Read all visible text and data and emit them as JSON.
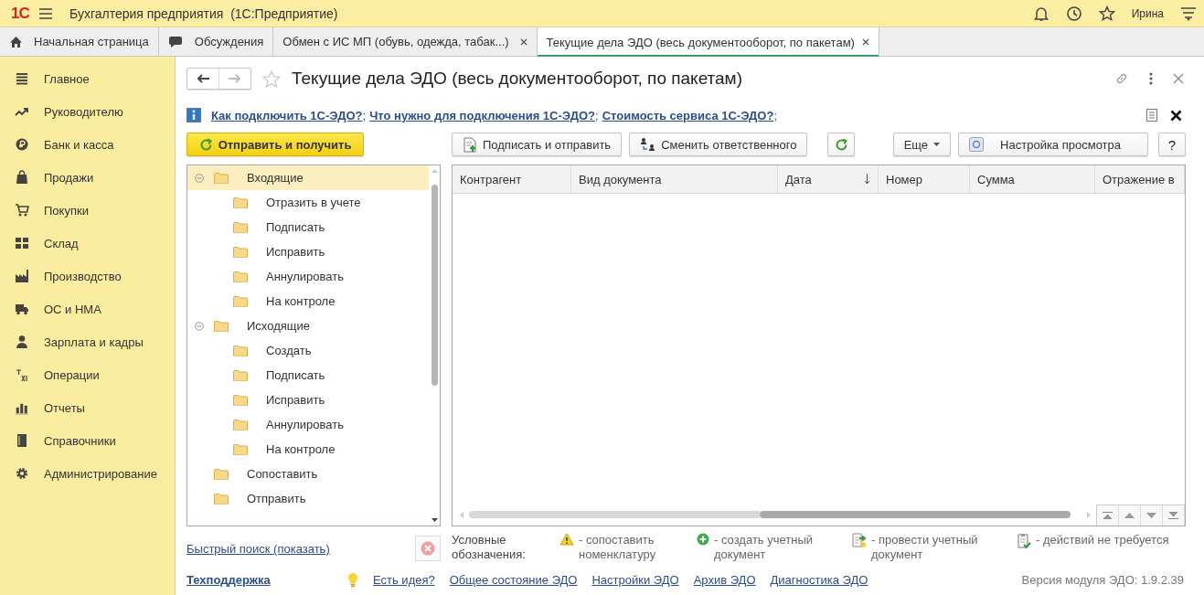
{
  "app": {
    "logo": "1С",
    "title": "Бухгалтерия предприятия  (1С:Предприятие)",
    "user": "Ирина"
  },
  "tabs": [
    {
      "label": "Начальная страница",
      "kind": "home",
      "selected": false,
      "closable": false
    },
    {
      "label": "Обсуждения",
      "kind": "chat",
      "selected": false,
      "closable": false
    },
    {
      "label": "Обмен с ИС МП (обувь, одежда, табак...)",
      "kind": "plain",
      "selected": false,
      "closable": true
    },
    {
      "label": "Текущие дела ЭДО (весь документооборот, по пакетам)",
      "kind": "plain",
      "selected": true,
      "closable": true
    }
  ],
  "sidebar": {
    "items": [
      {
        "label": "Главное"
      },
      {
        "label": "Руководителю"
      },
      {
        "label": "Банк и касса"
      },
      {
        "label": "Продажи"
      },
      {
        "label": "Покупки"
      },
      {
        "label": "Склад"
      },
      {
        "label": "Производство"
      },
      {
        "label": "ОС и НМА"
      },
      {
        "label": "Зарплата и кадры"
      },
      {
        "label": "Операции"
      },
      {
        "label": "Отчеты"
      },
      {
        "label": "Справочники"
      },
      {
        "label": "Администрирование"
      }
    ]
  },
  "form": {
    "title": "Текущие дела ЭДО (весь документооборот, по пакетам)",
    "favorite": false,
    "info_links": [
      {
        "label": "Как подключить 1С-ЭДО?",
        "separator": ";"
      },
      {
        "label": "Что нужно для подключения 1С-ЭДО?",
        "separator": ";"
      },
      {
        "label": "Стоимость сервиса 1С-ЭДО?",
        "separator": ";"
      }
    ],
    "toolbar": [
      {
        "kind": "primary",
        "label": "Отправить и получить"
      },
      {
        "kind": "sign",
        "label": "Подписать и отправить"
      },
      {
        "kind": "responsible",
        "label": "Сменить ответственного"
      },
      {
        "kind": "refresh"
      },
      {
        "kind": "menu",
        "label": "Еще"
      },
      {
        "kind": "view",
        "label": "Настройка просмотра"
      },
      {
        "kind": "help",
        "label": "?"
      }
    ],
    "tree": [
      {
        "label": "Входящие",
        "expanded": true,
        "selected": true,
        "children": [
          {
            "label": "Отразить в учете",
            "selected": false
          },
          {
            "label": "Подписать",
            "selected": false
          },
          {
            "label": "Исправить",
            "selected": false
          },
          {
            "label": "Аннулировать",
            "selected": false
          },
          {
            "label": "На контроле",
            "selected": false
          }
        ]
      },
      {
        "label": "Исходящие",
        "expanded": true,
        "selected": false,
        "children": [
          {
            "label": "Создать",
            "selected": false
          },
          {
            "label": "Подписать",
            "selected": false
          },
          {
            "label": "Исправить",
            "selected": false
          },
          {
            "label": "Аннулировать",
            "selected": false
          },
          {
            "label": "На контроле",
            "selected": false
          }
        ]
      },
      {
        "label": "Сопоставить",
        "selected": false
      },
      {
        "label": "Отправить",
        "selected": false
      }
    ],
    "table": {
      "columns": [
        {
          "label": "Контрагент",
          "sorted_descending": false
        },
        {
          "label": "Вид документа",
          "sorted_descending": false
        },
        {
          "label": "Дата",
          "sorted_descending": true
        },
        {
          "label": "Номер",
          "sorted_descending": false
        },
        {
          "label": "Сумма",
          "sorted_descending": false
        },
        {
          "label": "Отражение в",
          "sorted_descending": false
        }
      ]
    },
    "quick_search": "Быстрый поиск (показать)",
    "legend": {
      "title": "Условные обозначения:",
      "items": [
        {
          "kind": "warning",
          "label": "- сопоставить номенклатуру"
        },
        {
          "kind": "create",
          "label": "- создать учетный документ"
        },
        {
          "kind": "post",
          "label": "- провести учетный документ"
        },
        {
          "kind": "none",
          "label": "- действий не требуется"
        }
      ]
    },
    "footer": {
      "support": "Техподдержка",
      "links": [
        "Есть идея?",
        "Общее состояние ЭДО",
        "Настройки ЭДО",
        "Архив ЭДО",
        "Диагностика ЭДО"
      ],
      "version": "Версия модуля ЭДО: 1.9.2.39"
    }
  }
}
